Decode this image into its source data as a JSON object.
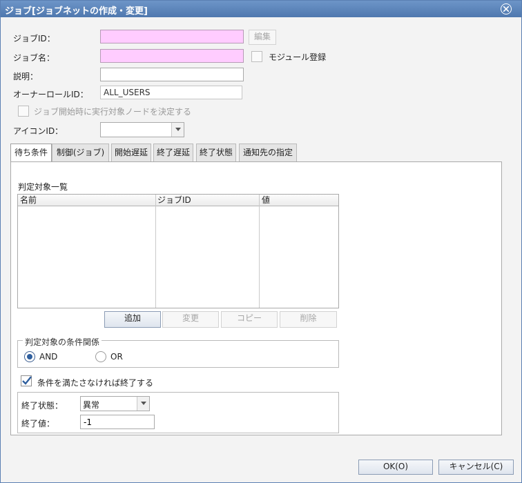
{
  "window": {
    "title": "ジョブ[ジョブネットの作成・変更]"
  },
  "form": {
    "job_id_label": "ジョブID：",
    "job_id_value": "",
    "edit_button": "編集",
    "job_name_label": "ジョブ名：",
    "job_name_value": "",
    "module_register_label": "モジュール登録",
    "description_label": "説明：",
    "description_value": "",
    "owner_role_label": "オーナーロールID：",
    "owner_role_value": "ALL_USERS",
    "decide_node_label": "ジョブ開始時に実行対象ノードを決定する",
    "icon_id_label": "アイコンID：",
    "icon_id_value": ""
  },
  "tabs": [
    {
      "label": "待ち条件"
    },
    {
      "label": "制御(ジョブ)"
    },
    {
      "label": "開始遅延"
    },
    {
      "label": "終了遅延"
    },
    {
      "label": "終了状態"
    },
    {
      "label": "通知先の指定"
    }
  ],
  "wait": {
    "list_title": "判定対象一覧",
    "columns": [
      "名前",
      "ジョブID",
      "値"
    ],
    "rows": [],
    "buttons": {
      "add": "追加",
      "modify": "変更",
      "copy": "コピー",
      "delete": "削除"
    },
    "relation_title": "判定対象の条件関係",
    "relation_options": [
      "AND",
      "OR"
    ],
    "relation_selected": "AND",
    "end_if_unmet_label": "条件を満たさなければ終了する",
    "end_if_unmet_checked": true,
    "end_status_label": "終了状態：",
    "end_status_value": "異常",
    "end_value_label": "終了値：",
    "end_value_value": "-1"
  },
  "footer": {
    "ok": "OK(O)",
    "cancel": "キャンセル(C)"
  }
}
